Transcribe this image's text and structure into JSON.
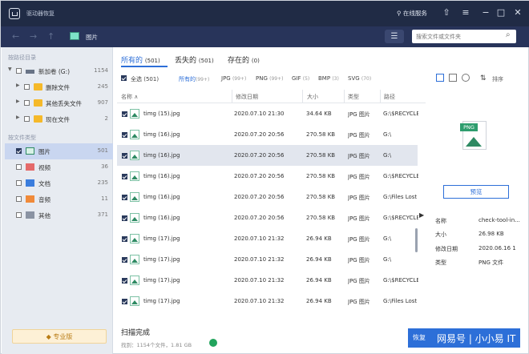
{
  "titlebar": {
    "app_title": "驱动器恢复",
    "online": "在线服务"
  },
  "nav": {
    "path": "图片",
    "search_placeholder": "搜索文件或文件夹"
  },
  "sidebar": {
    "location_header": "按路径目录",
    "drive": {
      "label": "新加卷 (G:)",
      "count": "1154"
    },
    "folders": [
      {
        "label": "删除文件",
        "count": "245"
      },
      {
        "label": "其他丢失文件",
        "count": "907"
      },
      {
        "label": "现在文件",
        "count": "2"
      }
    ],
    "type_header": "按文件类型",
    "types": [
      {
        "label": "图片",
        "count": "501"
      },
      {
        "label": "视频",
        "count": "36"
      },
      {
        "label": "文档",
        "count": "235"
      },
      {
        "label": "音频",
        "count": "11"
      },
      {
        "label": "其他",
        "count": "371"
      }
    ],
    "pro_label": "专业版"
  },
  "tabs": [
    {
      "label": "所有的",
      "count": "(501)"
    },
    {
      "label": "丢失的",
      "count": "(501)"
    },
    {
      "label": "存在的",
      "count": "(0)"
    }
  ],
  "filters": {
    "select_all": "全选",
    "select_all_count": "(501)",
    "items": [
      {
        "label": "所有的",
        "count": "(99+)"
      },
      {
        "label": "JPG",
        "count": "(99+)"
      },
      {
        "label": "PNG",
        "count": "(99+)"
      },
      {
        "label": "GIF",
        "count": "(5)"
      },
      {
        "label": "BMP",
        "count": "(3)"
      },
      {
        "label": "SVG",
        "count": "(70)"
      }
    ],
    "sort_label": "排序"
  },
  "columns": {
    "name": "名称",
    "modified": "修改日期",
    "size": "大小",
    "type": "类型",
    "path": "路径"
  },
  "rows": [
    {
      "name": "timg (15).jpg",
      "date": "2020.07.10 21:30",
      "size": "34.64 KB",
      "type": "JPG 图片",
      "path": "G:\\$RECYCLE"
    },
    {
      "name": "timg (16).jpg",
      "date": "2020.07.20 20:56",
      "size": "270.58 KB",
      "type": "JPG 图片",
      "path": "G:\\"
    },
    {
      "name": "timg (16).jpg",
      "date": "2020.07.20 20:56",
      "size": "270.58 KB",
      "type": "JPG 图片",
      "path": "G:\\"
    },
    {
      "name": "timg (16).jpg",
      "date": "2020.07.20 20:56",
      "size": "270.58 KB",
      "type": "JPG 图片",
      "path": "G:\\$RECYCLE"
    },
    {
      "name": "timg (16).jpg",
      "date": "2020.07.20 20:56",
      "size": "270.58 KB",
      "type": "JPG 图片",
      "path": "G:\\Files Lost C"
    },
    {
      "name": "timg (16).jpg",
      "date": "2020.07.20 20:56",
      "size": "270.58 KB",
      "type": "JPG 图片",
      "path": "G:\\$RECYCLE"
    },
    {
      "name": "timg (17).jpg",
      "date": "2020.07.10 21:32",
      "size": "26.94 KB",
      "type": "JPG 图片",
      "path": "G:\\"
    },
    {
      "name": "timg (17).jpg",
      "date": "2020.07.10 21:32",
      "size": "26.94 KB",
      "type": "JPG 图片",
      "path": "G:\\"
    },
    {
      "name": "timg (17).jpg",
      "date": "2020.07.10 21:32",
      "size": "26.94 KB",
      "type": "JPG 图片",
      "path": "G:\\$RECYCLE"
    },
    {
      "name": "timg (17).jpg",
      "date": "2020.07.10 21:32",
      "size": "26.94 KB",
      "type": "JPG 图片",
      "path": "G:\\Files Lost C"
    }
  ],
  "details": {
    "badge": "PNG",
    "preview_label": "预览",
    "fields": [
      {
        "key": "名称",
        "value": "check-tool-in..."
      },
      {
        "key": "大小",
        "value": "26.98 KB"
      },
      {
        "key": "修改日期",
        "value": "2020.06.16 1"
      },
      {
        "key": "类型",
        "value": "PNG 文件"
      }
    ]
  },
  "status": {
    "title": "扫描完成",
    "detail": "找到：1154个文件，1.81 GB"
  },
  "recover_label": "恢复",
  "watermark": "网易号 | 小小易 IT"
}
